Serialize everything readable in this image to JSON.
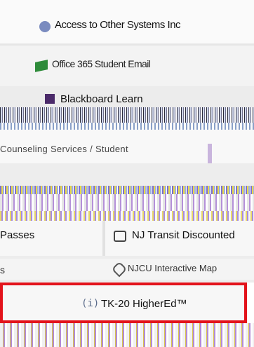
{
  "links": {
    "systems": "Access to Other Systems Inc",
    "office365": "Office 365 Student Email",
    "blackboard": "Blackboard Learn",
    "counseling": "Counseling Services / Student",
    "passes": "Passes",
    "nj_transit": "NJ Transit Discounted",
    "map": "NJCU Interactive Map",
    "tk20": "TK-20 HigherEd™"
  },
  "tk20_icon_text": "(i)",
  "colors": {
    "highlight_border": "#e3131b",
    "office_icon": "#2e8b3a",
    "blackboard_icon": "#4b2a6a"
  }
}
